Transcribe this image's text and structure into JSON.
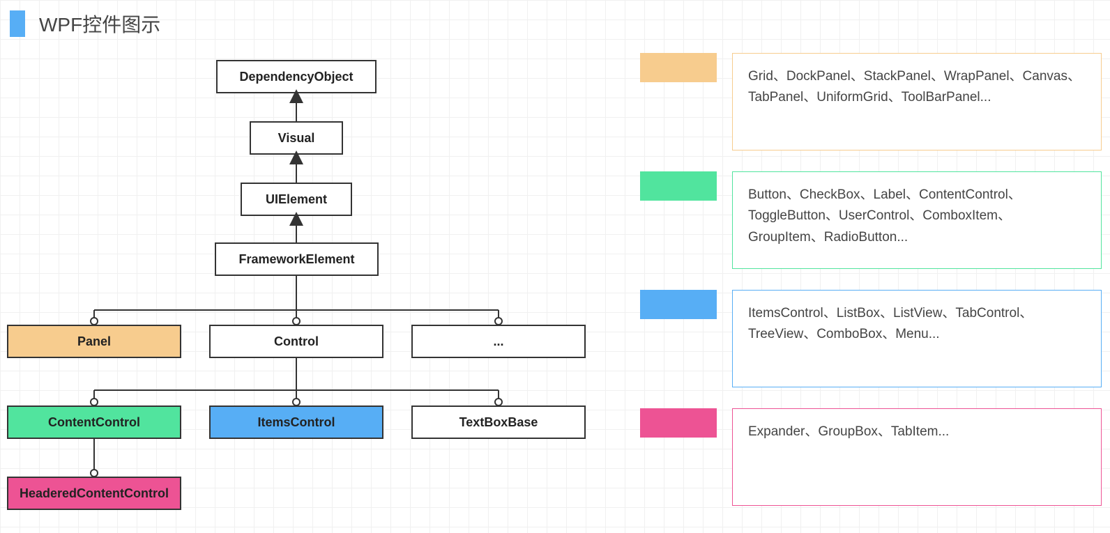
{
  "title": "WPF控件图示",
  "nodes": {
    "dependency_object": "DependencyObject",
    "visual": "Visual",
    "ui_element": "UIElement",
    "framework_element": "FrameworkElement",
    "panel": "Panel",
    "control": "Control",
    "ellipsis": "...",
    "content_control": "ContentControl",
    "items_control": "ItemsControl",
    "textbox_base": "TextBoxBase",
    "headered_content_control": "HeaderedContentControl"
  },
  "legend": {
    "panel": "Grid、DockPanel、StackPanel、WrapPanel、Canvas、TabPanel、UniformGrid、ToolBarPanel...",
    "content_control": "Button、CheckBox、Label、ContentControl、ToggleButton、UserControl、ComboxItem、GroupItem、RadioButton...",
    "items_control": "ItemsControl、ListBox、ListView、TabControl、TreeView、ComboBox、Menu...",
    "headered_content_control": "Expander、GroupBox、TabItem..."
  },
  "colors": {
    "orange": "#f7cc8e",
    "green": "#51e49e",
    "blue": "#57aef5",
    "pink": "#ed5394"
  }
}
